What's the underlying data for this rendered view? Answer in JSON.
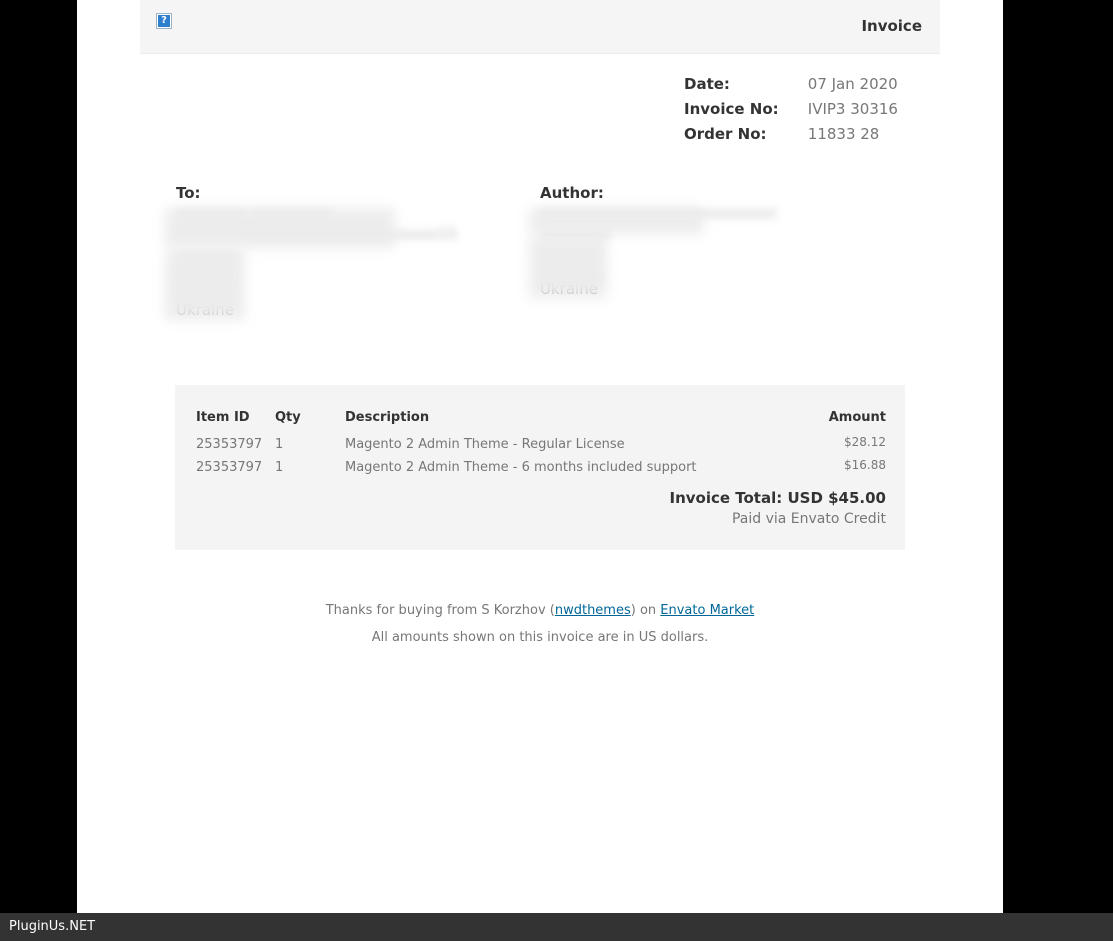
{
  "header": {
    "image_alt": "?",
    "title": "Invoice"
  },
  "meta": {
    "date_label": "Date:",
    "date_value": "07 Jan 2020",
    "invoice_label": "Invoice No:",
    "invoice_value": "IVIP3    30316",
    "order_label": "Order No:",
    "order_value": "11833   28"
  },
  "to": {
    "label": "To:",
    "lines": [
      "xxxxxxxx xxxxxxxxx",
      "xxxxxxxx xxxxxxxxxxxxxxxxxxxxx15",
      "xxxxxxx",
      "xxxxxx",
      "xxxxxx",
      "Ukraine"
    ]
  },
  "author": {
    "label": "Author:",
    "lines": [
      "xxxxxxxxxxxxxxxxxxxxxxxxxx)",
      "xxxxxxxx",
      "xxxxxxx",
      "xxxxxxx",
      "Ukraine"
    ]
  },
  "items": {
    "headers": {
      "item_id": "Item ID",
      "qty": "Qty",
      "description": "Description",
      "amount": "Amount"
    },
    "rows": [
      {
        "item_id": "25353797",
        "qty": "1",
        "description": "Magento 2 Admin Theme - Regular License",
        "amount": "$28.12"
      },
      {
        "item_id": "25353797",
        "qty": "1",
        "description": "Magento 2 Admin Theme - 6 months included support",
        "amount": "$16.88"
      }
    ],
    "total": "Invoice Total: USD $45.00",
    "paid_via": "Paid via Envato Credit"
  },
  "footer": {
    "thanks_prefix": "Thanks for buying from S Korzhov (",
    "author_link": "nwdthemes",
    "thanks_middle": ") on ",
    "market_link": "Envato Market",
    "note": "All amounts shown on this invoice are in US dollars."
  },
  "status_bar": {
    "text": "PluginUs.NET"
  },
  "colors": {
    "link": "#006699",
    "panel": "#f4f4f4",
    "muted_text": "#777777"
  }
}
